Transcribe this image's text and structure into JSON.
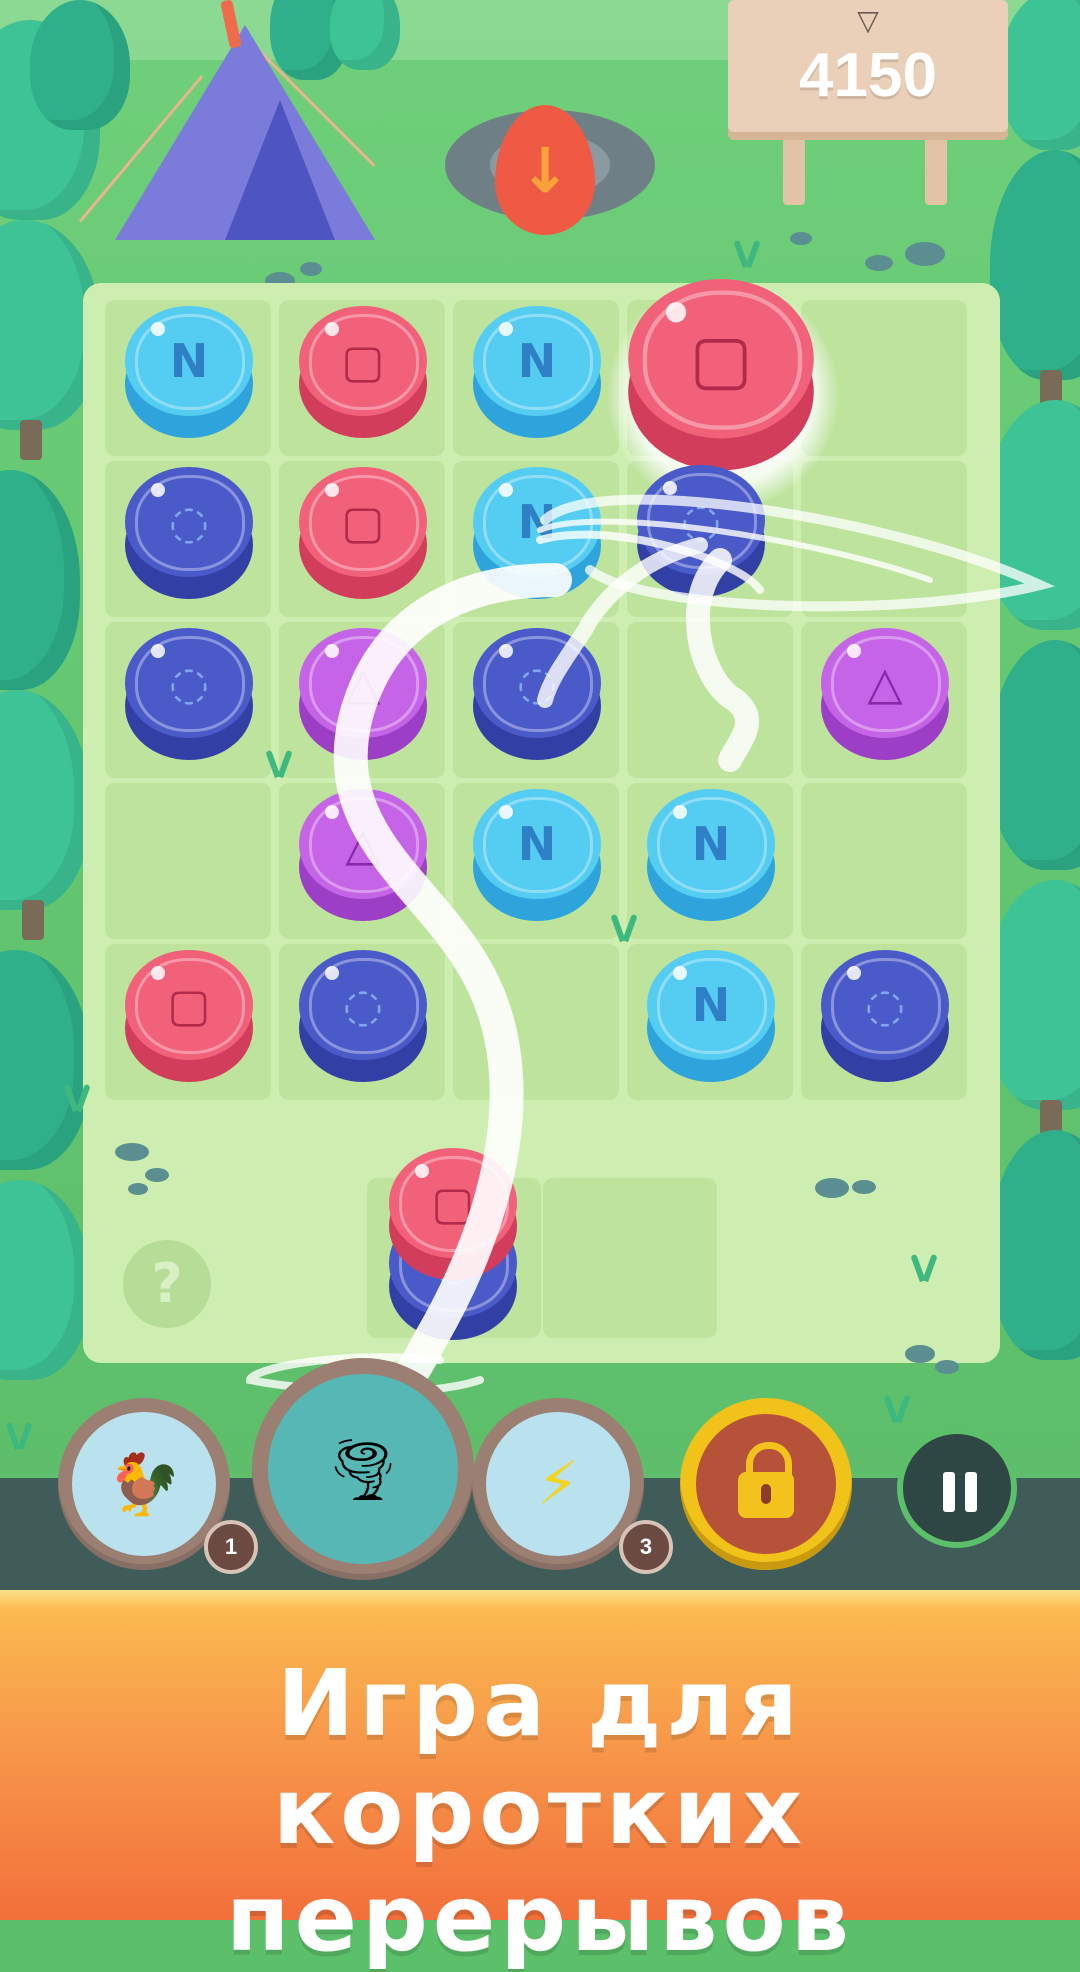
{
  "hud": {
    "score": "4150",
    "trophy_icon": "trophy-icon"
  },
  "board": {
    "rows": [
      [
        "cyan",
        "red",
        "cyan",
        "red",
        ""
      ],
      [
        "navy",
        "red",
        "cyan",
        "navy",
        ""
      ],
      [
        "navy",
        "purple",
        "navy",
        "",
        "purple"
      ],
      [
        "",
        "purple",
        "cyan",
        "cyan",
        ""
      ],
      [
        "red",
        "navy",
        "",
        "cyan",
        "navy"
      ]
    ],
    "tray": [
      "red",
      ""
    ],
    "help_label": "?"
  },
  "chip_symbols": {
    "cyan": "N",
    "red": "▢",
    "navy": "◌",
    "purple": "△"
  },
  "colors": {
    "cyan": "#55cdf2",
    "red": "#f2617a",
    "navy": "#4a5bc9",
    "purple": "#c664e8",
    "board": "#cdeeb0",
    "bar": "#3f5c58",
    "lock_gold": "#f1c21a"
  },
  "powerups": [
    {
      "name": "weathervane",
      "icon": "weathervane-icon",
      "count": "1"
    },
    {
      "name": "tornado",
      "icon": "tornado-icon",
      "count": ""
    },
    {
      "name": "lightning",
      "icon": "lightning-icon",
      "count": "3"
    }
  ],
  "locked_powerup": {
    "icon": "padlock-icon"
  },
  "pause": {
    "icon": "pause-icon"
  },
  "banner": {
    "line1": "Игра для",
    "line2": "коротких перерывов"
  }
}
